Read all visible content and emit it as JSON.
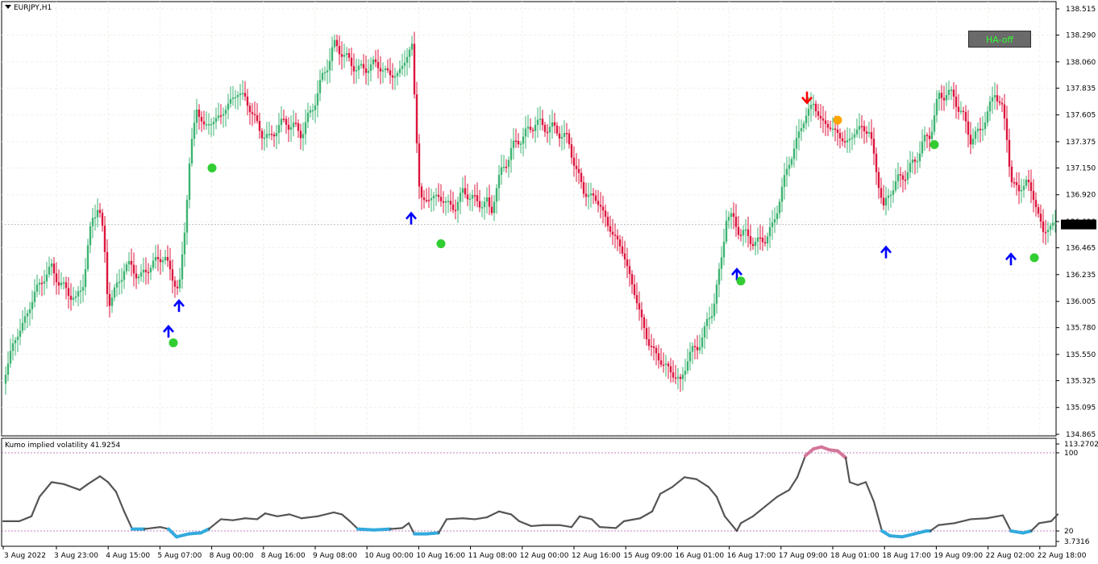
{
  "main_panel": {
    "symbol_timeframe": "EURJPY,H1",
    "ha_button_label": "HA-off",
    "price_ticks": [
      "138.515",
      "138.290",
      "138.060",
      "137.835",
      "137.605",
      "137.375",
      "137.150",
      "136.920",
      "136.690",
      "136.465",
      "136.235",
      "136.005",
      "135.780",
      "135.550",
      "135.325",
      "135.095",
      "134.865"
    ],
    "current_price": "136.665",
    "colors": {
      "bull": "#3cb371",
      "bear": "#dc143c",
      "up_arrow": "#0000ff",
      "down_arrow": "#ff0000",
      "dot_green": "#32cd32",
      "dot_orange": "#ffa500"
    }
  },
  "sub_panel": {
    "title": "Kumo implied volatility 41.9254",
    "ticks": [
      "113.2702",
      "100",
      "20",
      "3.7316"
    ],
    "colors": {
      "line": "#555555",
      "low": "#33aadd",
      "high": "#d3769a",
      "level": "#aa55aa"
    }
  },
  "time_axis": {
    "labels": [
      "3 Aug 2022",
      "3 Aug 23:00",
      "4 Aug 15:00",
      "5 Aug 07:00",
      "8 Aug 00:00",
      "8 Aug 16:00",
      "9 Aug 08:00",
      "10 Aug 00:00",
      "10 Aug 16:00",
      "11 Aug 08:00",
      "12 Aug 00:00",
      "12 Aug 16:00",
      "15 Aug 09:00",
      "16 Aug 01:00",
      "16 Aug 17:00",
      "17 Aug 09:00",
      "18 Aug 01:00",
      "18 Aug 17:00",
      "19 Aug 09:00",
      "22 Aug 02:00",
      "22 Aug 18:00"
    ]
  },
  "chart_data": {
    "type": "candlestick",
    "symbol": "EURJPY",
    "timeframe": "H1",
    "close_path": [
      [
        0,
        135.3
      ],
      [
        10,
        135.6
      ],
      [
        20,
        135.75
      ],
      [
        30,
        135.9
      ],
      [
        40,
        136.1
      ],
      [
        50,
        136.2
      ],
      [
        60,
        136.3
      ],
      [
        70,
        136.15
      ],
      [
        80,
        136.1
      ],
      [
        90,
        136.0
      ],
      [
        100,
        136.2
      ],
      [
        110,
        136.7
      ],
      [
        118,
        136.85
      ],
      [
        125,
        136.5
      ],
      [
        130,
        136.0
      ],
      [
        140,
        136.1
      ],
      [
        150,
        136.3
      ],
      [
        160,
        136.3
      ],
      [
        170,
        136.2
      ],
      [
        180,
        136.3
      ],
      [
        190,
        136.35
      ],
      [
        200,
        136.4
      ],
      [
        210,
        136.2
      ],
      [
        218,
        136.1
      ],
      [
        225,
        136.6
      ],
      [
        232,
        137.3
      ],
      [
        240,
        137.65
      ],
      [
        250,
        137.5
      ],
      [
        260,
        137.55
      ],
      [
        270,
        137.6
      ],
      [
        280,
        137.7
      ],
      [
        290,
        137.8
      ],
      [
        300,
        137.75
      ],
      [
        310,
        137.6
      ],
      [
        320,
        137.45
      ],
      [
        330,
        137.4
      ],
      [
        340,
        137.5
      ],
      [
        350,
        137.55
      ],
      [
        360,
        137.5
      ],
      [
        370,
        137.45
      ],
      [
        380,
        137.6
      ],
      [
        390,
        137.8
      ],
      [
        400,
        138.0
      ],
      [
        410,
        138.2
      ],
      [
        420,
        138.15
      ],
      [
        430,
        138.05
      ],
      [
        440,
        138.0
      ],
      [
        450,
        138.0
      ],
      [
        460,
        138.05
      ],
      [
        470,
        138.0
      ],
      [
        480,
        137.95
      ],
      [
        490,
        137.95
      ],
      [
        500,
        138.1
      ],
      [
        507,
        138.2
      ],
      [
        512,
        137.5
      ],
      [
        516,
        137.0
      ],
      [
        520,
        136.85
      ],
      [
        530,
        136.9
      ],
      [
        540,
        136.9
      ],
      [
        550,
        136.85
      ],
      [
        560,
        136.8
      ],
      [
        570,
        136.95
      ],
      [
        580,
        136.9
      ],
      [
        590,
        136.85
      ],
      [
        600,
        136.85
      ],
      [
        605,
        136.75
      ],
      [
        610,
        136.95
      ],
      [
        620,
        137.15
      ],
      [
        630,
        137.3
      ],
      [
        640,
        137.4
      ],
      [
        650,
        137.45
      ],
      [
        660,
        137.55
      ],
      [
        670,
        137.5
      ],
      [
        680,
        137.5
      ],
      [
        690,
        137.45
      ],
      [
        700,
        137.4
      ],
      [
        710,
        137.15
      ],
      [
        720,
        136.95
      ],
      [
        730,
        136.9
      ],
      [
        740,
        136.85
      ],
      [
        750,
        136.65
      ],
      [
        760,
        136.55
      ],
      [
        770,
        136.4
      ],
      [
        780,
        136.15
      ],
      [
        790,
        135.9
      ],
      [
        800,
        135.65
      ],
      [
        810,
        135.55
      ],
      [
        820,
        135.45
      ],
      [
        830,
        135.4
      ],
      [
        840,
        135.3
      ],
      [
        850,
        135.55
      ],
      [
        860,
        135.6
      ],
      [
        870,
        135.75
      ],
      [
        880,
        135.95
      ],
      [
        890,
        136.3
      ],
      [
        897,
        136.75
      ],
      [
        905,
        136.7
      ],
      [
        915,
        136.6
      ],
      [
        925,
        136.55
      ],
      [
        935,
        136.5
      ],
      [
        945,
        136.55
      ],
      [
        955,
        136.65
      ],
      [
        965,
        136.95
      ],
      [
        975,
        137.2
      ],
      [
        985,
        137.4
      ],
      [
        995,
        137.6
      ],
      [
        1005,
        137.7
      ],
      [
        1015,
        137.55
      ],
      [
        1025,
        137.5
      ],
      [
        1035,
        137.45
      ],
      [
        1045,
        137.35
      ],
      [
        1055,
        137.45
      ],
      [
        1065,
        137.5
      ],
      [
        1075,
        137.45
      ],
      [
        1085,
        137.05
      ],
      [
        1092,
        136.8
      ],
      [
        1100,
        136.95
      ],
      [
        1110,
        137.05
      ],
      [
        1120,
        137.1
      ],
      [
        1130,
        137.2
      ],
      [
        1140,
        137.35
      ],
      [
        1150,
        137.45
      ],
      [
        1160,
        137.75
      ],
      [
        1170,
        137.8
      ],
      [
        1180,
        137.75
      ],
      [
        1190,
        137.6
      ],
      [
        1200,
        137.4
      ],
      [
        1210,
        137.45
      ],
      [
        1220,
        137.6
      ],
      [
        1230,
        137.8
      ],
      [
        1240,
        137.65
      ],
      [
        1245,
        137.4
      ],
      [
        1250,
        137.05
      ],
      [
        1260,
        136.95
      ],
      [
        1270,
        137.05
      ],
      [
        1280,
        136.85
      ],
      [
        1290,
        136.6
      ],
      [
        1300,
        136.65
      ],
      [
        1308,
        136.7
      ]
    ],
    "signals": {
      "up_arrows": [
        [
          205,
          135.75
        ],
        [
          218,
          135.97
        ],
        [
          506,
          136.72
        ],
        [
          910,
          136.24
        ],
        [
          1095,
          136.43
        ],
        [
          1250,
          136.37
        ]
      ],
      "down_arrows": [
        [
          997,
          137.75
        ]
      ],
      "dots_green": [
        [
          211,
          135.65
        ],
        [
          259,
          137.15
        ],
        [
          543,
          136.5
        ],
        [
          915,
          136.18
        ],
        [
          1155,
          137.35
        ],
        [
          1279,
          136.38
        ]
      ],
      "dots_orange": [
        [
          1035,
          137.56
        ]
      ]
    },
    "volatility": {
      "ylim": [
        3.7316,
        113.2702
      ],
      "levels": [
        100,
        20
      ],
      "path": [
        [
          0,
          30
        ],
        [
          20,
          30
        ],
        [
          35,
          35
        ],
        [
          45,
          55
        ],
        [
          60,
          70
        ],
        [
          75,
          68
        ],
        [
          95,
          62
        ],
        [
          105,
          68
        ],
        [
          120,
          76
        ],
        [
          130,
          70
        ],
        [
          140,
          60
        ],
        [
          150,
          40
        ],
        [
          160,
          22
        ],
        [
          175,
          22
        ],
        [
          195,
          24
        ],
        [
          205,
          22
        ],
        [
          215,
          14
        ],
        [
          230,
          17
        ],
        [
          245,
          18
        ],
        [
          255,
          22
        ],
        [
          270,
          32
        ],
        [
          285,
          31
        ],
        [
          300,
          33
        ],
        [
          315,
          32
        ],
        [
          325,
          38
        ],
        [
          340,
          35
        ],
        [
          355,
          37
        ],
        [
          370,
          33
        ],
        [
          390,
          35
        ],
        [
          410,
          39
        ],
        [
          420,
          37
        ],
        [
          430,
          30
        ],
        [
          440,
          22
        ],
        [
          460,
          21
        ],
        [
          480,
          22
        ],
        [
          495,
          23
        ],
        [
          503,
          28
        ],
        [
          510,
          17
        ],
        [
          525,
          17
        ],
        [
          540,
          18
        ],
        [
          550,
          32
        ],
        [
          570,
          33
        ],
        [
          585,
          32
        ],
        [
          600,
          34
        ],
        [
          615,
          40
        ],
        [
          630,
          37
        ],
        [
          640,
          30
        ],
        [
          655,
          25
        ],
        [
          670,
          26
        ],
        [
          690,
          26
        ],
        [
          705,
          24
        ],
        [
          715,
          35
        ],
        [
          730,
          32
        ],
        [
          740,
          24
        ],
        [
          760,
          23
        ],
        [
          770,
          30
        ],
        [
          790,
          33
        ],
        [
          805,
          40
        ],
        [
          815,
          58
        ],
        [
          830,
          65
        ],
        [
          845,
          75
        ],
        [
          860,
          73
        ],
        [
          875,
          65
        ],
        [
          885,
          55
        ],
        [
          895,
          35
        ],
        [
          905,
          25
        ],
        [
          910,
          20
        ],
        [
          915,
          28
        ],
        [
          930,
          35
        ],
        [
          945,
          45
        ],
        [
          960,
          55
        ],
        [
          975,
          62
        ],
        [
          985,
          75
        ],
        [
          995,
          97
        ],
        [
          1005,
          104
        ],
        [
          1015,
          106
        ],
        [
          1025,
          103
        ],
        [
          1035,
          102
        ],
        [
          1045,
          95
        ],
        [
          1050,
          70
        ],
        [
          1060,
          67
        ],
        [
          1070,
          70
        ],
        [
          1080,
          50
        ],
        [
          1090,
          20
        ],
        [
          1100,
          15
        ],
        [
          1115,
          14
        ],
        [
          1130,
          17
        ],
        [
          1145,
          20
        ],
        [
          1150,
          20
        ],
        [
          1160,
          26
        ],
        [
          1180,
          28
        ],
        [
          1200,
          32
        ],
        [
          1220,
          33
        ],
        [
          1240,
          36
        ],
        [
          1245,
          28
        ],
        [
          1250,
          20
        ],
        [
          1265,
          18
        ],
        [
          1275,
          20
        ],
        [
          1285,
          28
        ],
        [
          1300,
          30
        ],
        [
          1308,
          37
        ]
      ]
    }
  }
}
